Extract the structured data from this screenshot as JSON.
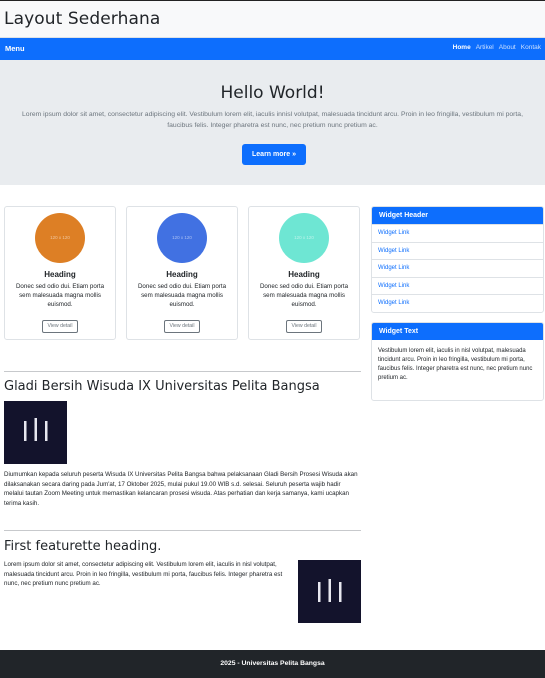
{
  "header": {
    "title": "Layout Sederhana"
  },
  "navbar": {
    "brand": "Menu",
    "links": [
      "Home",
      "Artikel",
      "About",
      "Kontak"
    ]
  },
  "hero": {
    "title": "Hello World!",
    "text": "Lorem ipsum dolor sit amet, consectetur adipiscing elit. Vestibulum lorem elit, iaculis innisl volutpat, malesuada tincidunt arcu. Proin in leo fringilla, vestibulum mi porta, faucibus felis. Integer pharetra est nunc, nec pretium nunc pretium ac.",
    "button": "Learn more »"
  },
  "cards": [
    {
      "placeholder": "120 x 120",
      "color": "#dd7f25",
      "heading": "Heading",
      "text": "Donec sed odio dui. Etiam porta sem malesuada magna mollis euismod.",
      "button": "View detail"
    },
    {
      "placeholder": "120 x 120",
      "color": "#4171e2",
      "heading": "Heading",
      "text": "Donec sed odio dui. Etiam porta sem malesuada magna mollis euismod.",
      "button": "View detail"
    },
    {
      "placeholder": "120 x 120",
      "color": "#6ee6d3",
      "heading": "Heading",
      "text": "Donec sed odio dui. Etiam porta sem malesuada magna mollis euismod.",
      "button": "View detail"
    }
  ],
  "widget_links": {
    "header": "Widget Header",
    "items": [
      "Widget Link",
      "Widget Link",
      "Widget Link",
      "Widget Link",
      "Widget Link"
    ]
  },
  "widget_text": {
    "header": "Widget Text",
    "body": "Vestibulum lorem elit, iaculis in nisl volutpat, malesuada tincidunt arcu. Proin in leo fringilla, vestibulum mi porta, faucibus felis. Integer pharetra est nunc, nec pretium nunc pretium ac."
  },
  "news": {
    "title": "Gladi Bersih Wisuda IX Universitas Pelita Bangsa",
    "text": "Diumumkan kepada seluruh peserta Wisuda IX Universitas Pelita Bangsa bahwa pelaksanaan Gladi Bersih Prosesi Wisuda akan dilaksanakan secara daring pada Jum'at, 17 Oktober 2025, mulai pukul 19.00 WIB s.d. selesai. Seluruh peserta wajib hadir melalui tautan Zoom Meeting untuk memastikan kelancaran prosesi wisuda. Atas perhatian dan kerja samanya, kami ucapkan terima kasih."
  },
  "featurette": {
    "title": "First featurette heading.",
    "text": "Lorem ipsum dolor sit amet, consectetur adipiscing elit. Vestibulum lorem elit, iaculis in nisl volutpat, malesuada tincidunt arcu. Proin in leo fringilla, vestibulum mi porta, faucibus felis. Integer pharetra est nunc, nec pretium nunc pretium ac."
  },
  "footer": {
    "text": "2025 - Universitas Pelita Bangsa"
  },
  "colors": {
    "primary": "#0d6efd",
    "hero_bg": "#e9ecef",
    "footer_bg": "#212529",
    "thumb_bg": "#13132c"
  },
  "icons": {
    "thumbnail": "logo-image"
  }
}
